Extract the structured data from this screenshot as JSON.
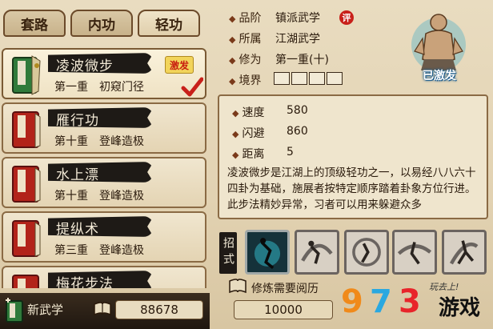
{
  "tabs": [
    {
      "label": "套路",
      "active": false
    },
    {
      "label": "内功",
      "active": false
    },
    {
      "label": "轻功",
      "active": true
    }
  ],
  "skills": [
    {
      "name": "凌波微步",
      "level": "第一重",
      "stage": "初窥门径",
      "badge": "激发",
      "selected": true,
      "book_color": "#2f7a3a"
    },
    {
      "name": "雁行功",
      "level": "第十重",
      "stage": "登峰造极",
      "selected": false,
      "book_color": "#b2231a"
    },
    {
      "name": "水上漂",
      "level": "第十重",
      "stage": "登峰造极",
      "selected": false,
      "book_color": "#b2231a"
    },
    {
      "name": "提纵术",
      "level": "第三重",
      "stage": "登峰造极",
      "selected": false,
      "book_color": "#b2231a"
    },
    {
      "name": "梅花步法",
      "selected": false,
      "book_color": "#b2231a"
    }
  ],
  "footer_left": {
    "new_label": "新武学",
    "money": "88678"
  },
  "info": {
    "grade_label": "品阶",
    "grade_value": "镇派武学",
    "grade_tag": "评",
    "belong_label": "所属",
    "belong_value": "江湖武学",
    "cultivation_label": "修为",
    "cultivation_value": "第一重(十)",
    "realm_label": "境界"
  },
  "avatar": {
    "status": "已激发"
  },
  "stats": [
    {
      "label": "速度",
      "value": "580"
    },
    {
      "label": "闪避",
      "value": "860"
    },
    {
      "label": "距离",
      "value": "5"
    }
  ],
  "description": "凌波微步是江湖上的顶级轻功之一，以易经八八六十四卦为基础，施展者按特定顺序踏着卦象方位行进。",
  "description_cut": "此步法精妙异常，习者可以用来躲避众多",
  "moves_label": "招式",
  "requirement": {
    "label": "修炼需要阅历",
    "value": "10000"
  },
  "watermark": {
    "digits": [
      "9",
      "7",
      "3"
    ],
    "text": "游戏",
    "slogan": "玩去上!"
  },
  "colors": {
    "accent_red": "#c8201a",
    "banner_dark": "#1e1a16",
    "parchment": "#efe5cd"
  }
}
